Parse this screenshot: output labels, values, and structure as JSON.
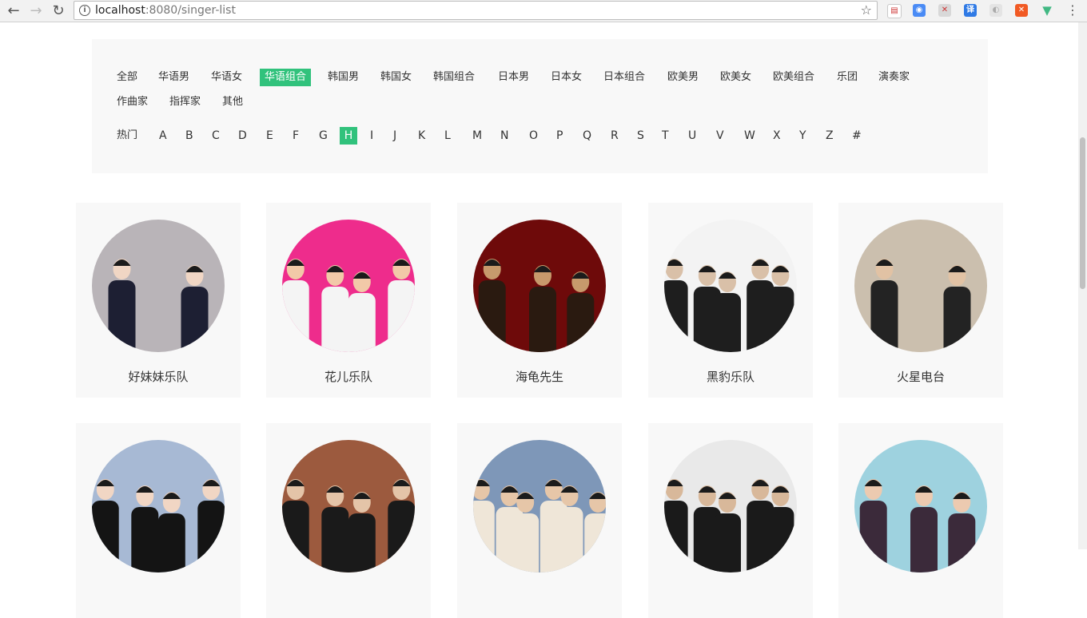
{
  "browser": {
    "url_host": "localhost",
    "url_rest": ":8080/singer-list"
  },
  "filters": {
    "categories": [
      {
        "label": "全部",
        "active": false
      },
      {
        "label": "华语男",
        "active": false
      },
      {
        "label": "华语女",
        "active": false
      },
      {
        "label": "华语组合",
        "active": true
      },
      {
        "label": "韩国男",
        "active": false
      },
      {
        "label": "韩国女",
        "active": false
      },
      {
        "label": "韩国组合",
        "active": false
      },
      {
        "label": "日本男",
        "active": false
      },
      {
        "label": "日本女",
        "active": false
      },
      {
        "label": "日本组合",
        "active": false
      },
      {
        "label": "欧美男",
        "active": false
      },
      {
        "label": "欧美女",
        "active": false
      },
      {
        "label": "欧美组合",
        "active": false
      },
      {
        "label": "乐团",
        "active": false
      },
      {
        "label": "演奏家",
        "active": false
      },
      {
        "label": "作曲家",
        "active": false
      },
      {
        "label": "指挥家",
        "active": false
      },
      {
        "label": "其他",
        "active": false
      }
    ],
    "letters": [
      {
        "label": "热门",
        "active": false
      },
      {
        "label": "A",
        "active": false
      },
      {
        "label": "B",
        "active": false
      },
      {
        "label": "C",
        "active": false
      },
      {
        "label": "D",
        "active": false
      },
      {
        "label": "E",
        "active": false
      },
      {
        "label": "F",
        "active": false
      },
      {
        "label": "G",
        "active": false
      },
      {
        "label": "H",
        "active": true
      },
      {
        "label": "I",
        "active": false
      },
      {
        "label": "J",
        "active": false
      },
      {
        "label": "K",
        "active": false
      },
      {
        "label": "L",
        "active": false
      },
      {
        "label": "M",
        "active": false
      },
      {
        "label": "N",
        "active": false
      },
      {
        "label": "O",
        "active": false
      },
      {
        "label": "P",
        "active": false
      },
      {
        "label": "Q",
        "active": false
      },
      {
        "label": "R",
        "active": false
      },
      {
        "label": "S",
        "active": false
      },
      {
        "label": "T",
        "active": false
      },
      {
        "label": "U",
        "active": false
      },
      {
        "label": "V",
        "active": false
      },
      {
        "label": "W",
        "active": false
      },
      {
        "label": "X",
        "active": false
      },
      {
        "label": "Y",
        "active": false
      },
      {
        "label": "Z",
        "active": false
      },
      {
        "label": "#",
        "active": false
      }
    ]
  },
  "singers": [
    {
      "name": "好妹妹乐队",
      "bg": "#b9b4b8",
      "fg": "#1d1f33",
      "skin": "#f0d6c4"
    },
    {
      "name": "花儿乐队",
      "bg": "#ee2c8c",
      "fg": "#f4f4f4",
      "skin": "#f2c9a8"
    },
    {
      "name": "海龟先生",
      "bg": "#6e0a0a",
      "fg": "#2a1a10",
      "skin": "#c79a6c"
    },
    {
      "name": "黑豹乐队",
      "bg": "#f3f3f3",
      "fg": "#1e1e1e",
      "skin": "#d9c0a8"
    },
    {
      "name": "火星电台",
      "bg": "#cbbfae",
      "fg": "#232323",
      "skin": "#e1c2a4"
    },
    {
      "name": "",
      "bg": "#a7b9d4",
      "fg": "#141414",
      "skin": "#f1d6c4"
    },
    {
      "name": "",
      "bg": "#9c5a3e",
      "fg": "#1a1a1a",
      "skin": "#e4c4a8"
    },
    {
      "name": "",
      "bg": "#7e97b8",
      "fg": "#efe6d8",
      "skin": "#e6c6a8"
    },
    {
      "name": "",
      "bg": "#e9e9e9",
      "fg": "#1a1a1a",
      "skin": "#d8b89a"
    },
    {
      "name": "",
      "bg": "#9ed2df",
      "fg": "#3b2a3a",
      "skin": "#eccab0"
    }
  ]
}
